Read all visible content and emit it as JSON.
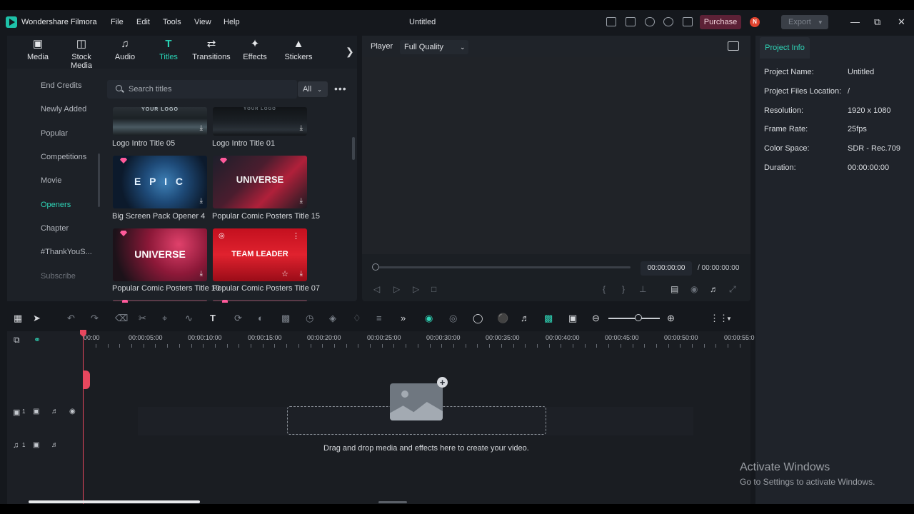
{
  "app": {
    "name": "Wondershare Filmora",
    "doc_title": "Untitled"
  },
  "menu": [
    "File",
    "Edit",
    "Tools",
    "View",
    "Help"
  ],
  "titlebar": {
    "purchase_label": "Purchase",
    "avatar_letter": "N",
    "export_label": "Export"
  },
  "library_tabs": [
    {
      "label": "Media",
      "icon": "media-icon"
    },
    {
      "label": "Stock Media",
      "icon": "stock-media-icon"
    },
    {
      "label": "Audio",
      "icon": "music-note-icon"
    },
    {
      "label": "Titles",
      "icon": "titles-icon",
      "active": true
    },
    {
      "label": "Transitions",
      "icon": "transitions-icon"
    },
    {
      "label": "Effects",
      "icon": "effects-icon"
    },
    {
      "label": "Stickers",
      "icon": "stickers-icon"
    }
  ],
  "sidebar": {
    "items": [
      {
        "label": "End Credits"
      },
      {
        "label": "Newly Added"
      },
      {
        "label": "Popular"
      },
      {
        "label": "Competitions"
      },
      {
        "label": "Movie"
      },
      {
        "label": "Openers",
        "active": true
      },
      {
        "label": "Chapter"
      },
      {
        "label": "#ThankYouS..."
      },
      {
        "label": "Subscribe"
      }
    ]
  },
  "search": {
    "placeholder": "Search titles",
    "filter_value": "All"
  },
  "titles": [
    {
      "label": "Logo Intro Title 05",
      "thumb_text": "YOUR LOGO"
    },
    {
      "label": "Logo Intro Title 01",
      "thumb_text": "YOUR LOGO"
    },
    {
      "label": "Big Screen Pack Opener 4",
      "thumb_text": "E P I C"
    },
    {
      "label": "Popular Comic Posters Title 15",
      "thumb_text": "UNIVERSE"
    },
    {
      "label": "Popular Comic Posters Title 10",
      "thumb_text": "UNIVERSE"
    },
    {
      "label": "Popular Comic Posters Title 07",
      "thumb_text": "TEAM LEADER"
    }
  ],
  "player": {
    "label": "Player",
    "quality": "Full Quality",
    "current_time": "00:00:00:00",
    "total_time": "/ 00:00:00:00",
    "progress": 0
  },
  "project_info": {
    "tab": "Project Info",
    "rows": [
      {
        "key": "Project Name:",
        "value": "Untitled"
      },
      {
        "key": "Project Files Location:",
        "value": "/"
      },
      {
        "key": "Resolution:",
        "value": "1920 x 1080"
      },
      {
        "key": "Frame Rate:",
        "value": "25fps"
      },
      {
        "key": "Color Space:",
        "value": "SDR - Rec.709"
      },
      {
        "key": "Duration:",
        "value": "00:00:00:00"
      }
    ]
  },
  "timeline": {
    "ruler": [
      "00:00",
      "00:00:05:00",
      "00:00:10:00",
      "00:00:15:00",
      "00:00:20:00",
      "00:00:25:00",
      "00:00:30:00",
      "00:00:35:00",
      "00:00:40:00",
      "00:00:45:00",
      "00:00:50:00",
      "00:00:55:0"
    ],
    "video_track": "1",
    "audio_track": "1",
    "drop_hint": "Drag and drop media and effects here to create your video."
  },
  "watermark": {
    "line1": "Activate Windows",
    "line2": "Go to Settings to activate Windows."
  }
}
